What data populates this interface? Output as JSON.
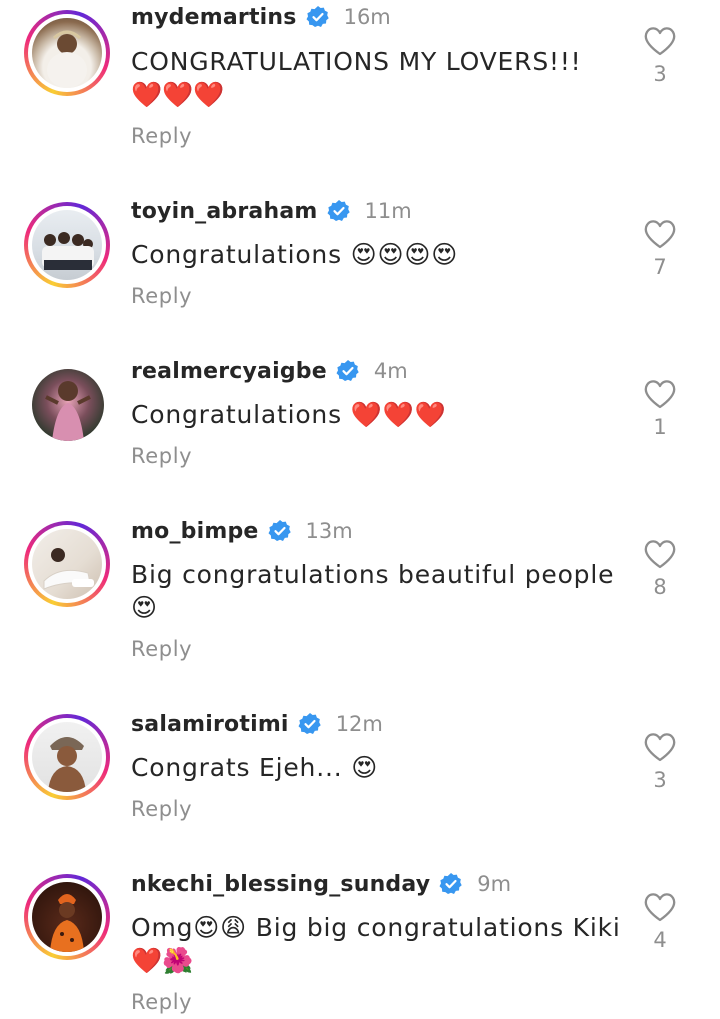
{
  "comments": [
    {
      "username": "mydemartins",
      "time": "16m",
      "line1": "CONGRATULATIONS MY LOVERS!!!",
      "line2": "❤️❤️❤️",
      "reply": "Reply",
      "likes": "3",
      "verified": true,
      "has_story_ring": true
    },
    {
      "username": "toyin_abraham",
      "time": "11m",
      "line1": "Congratulations 😍😍😍😍",
      "reply": "Reply",
      "likes": "7",
      "verified": true,
      "has_story_ring": true
    },
    {
      "username": "realmercyaigbe",
      "time": "4m",
      "line1": "Congratulations ❤️❤️❤️",
      "reply": "Reply",
      "likes": "1",
      "verified": true,
      "has_story_ring": false
    },
    {
      "username": "mo_bimpe",
      "time": "13m",
      "line1": "Big congratulations beautiful people",
      "line2": "😍",
      "reply": "Reply",
      "likes": "8",
      "verified": true,
      "has_story_ring": true
    },
    {
      "username": "salamirotimi",
      "time": "12m",
      "line1": "Congrats Ejeh... 😍",
      "reply": "Reply",
      "likes": "3",
      "verified": true,
      "has_story_ring": true
    },
    {
      "username": "nkechi_blessing_sunday",
      "time": "9m",
      "line1": "Omg😍😩 Big big congratulations Kiki",
      "line2": "❤️🌺",
      "reply": "Reply",
      "likes": "4",
      "verified": true,
      "has_story_ring": true
    }
  ],
  "colors": {
    "verified_badge": "#3897f0",
    "username": "#262626",
    "muted_text": "#8e8e8e",
    "heart_outline": "#8e8e8e",
    "story_ring_start": "#f9ce34",
    "story_ring_mid": "#ee2a7b",
    "story_ring_end": "#6228d7"
  },
  "icons": {
    "verified": "verified-badge-icon",
    "like": "heart-outline-icon"
  }
}
